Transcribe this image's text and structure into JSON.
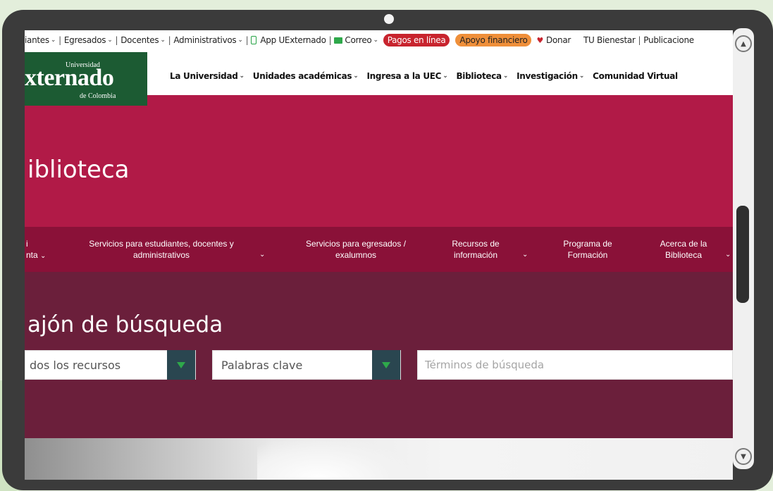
{
  "utility_bar": {
    "items": [
      {
        "label": "iantes",
        "has_chevron": true
      },
      {
        "label": "Egresados",
        "has_chevron": true
      },
      {
        "label": "Docentes",
        "has_chevron": true
      },
      {
        "label": "Administrativos",
        "has_chevron": true
      },
      {
        "label": "App UExternado",
        "has_chevron": false
      },
      {
        "label": "Correo",
        "has_chevron": true
      }
    ],
    "pagos_label": "Pagos en línea",
    "apoyo_label": "Apoyo financiero",
    "donar_label": "Donar",
    "bienestar_label": "TU Bienestar",
    "publicaciones_label": "Publicacione",
    "accent_red": "#c8242e",
    "accent_orange": "#ef8f3a"
  },
  "logo": {
    "top": "Universidad",
    "main": "xternado",
    "bottom": "de Colombia",
    "bg_color": "#1c5b33"
  },
  "main_nav": {
    "items": [
      {
        "label": "La Universidad",
        "has_chevron": true
      },
      {
        "label": "Unidades académicas",
        "has_chevron": true
      },
      {
        "label": "Ingresa a la UEC",
        "has_chevron": true
      },
      {
        "label": "Biblioteca",
        "has_chevron": true
      },
      {
        "label": "Investigación",
        "has_chevron": true
      },
      {
        "label": "Comunidad Virtual",
        "has_chevron": false
      }
    ]
  },
  "page_title": "iblioteca",
  "sub_nav": {
    "items": [
      {
        "line1": "i",
        "line2": "nta"
      },
      {
        "line1": "Servicios para estudiantes, docentes y",
        "line2": "administrativos"
      },
      {
        "line1": "Servicios para egresados /",
        "line2": "exalumnos"
      },
      {
        "line1": "Recursos de",
        "line2": "información"
      },
      {
        "line1": "Programa de",
        "line2": "Formación"
      },
      {
        "line1": "Acerca de la",
        "line2": "Biblioteca"
      }
    ]
  },
  "search": {
    "heading": "ajón de búsqueda",
    "scope_value": "dos los recursos",
    "field_value": "Palabras clave",
    "terms_placeholder": "Términos de búsqueda"
  },
  "colors": {
    "title_band": "#b11a47",
    "sub_nav": "#8a1138",
    "search_area": "#6b1f3b"
  }
}
